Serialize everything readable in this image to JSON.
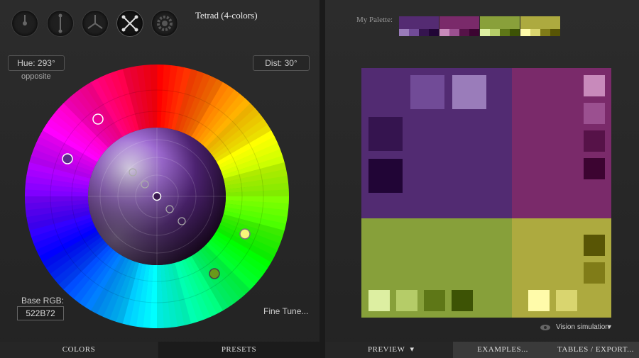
{
  "mode": {
    "title": "Tetrad (4-colors)",
    "icons": [
      "mono-icon",
      "complement-icon",
      "triad-icon",
      "tetrad-icon",
      "gear-icon"
    ],
    "active": "tetrad-icon"
  },
  "controls": {
    "hue_label": "Hue: 293°",
    "hue_sub": "opposite",
    "dist_label": "Dist: 30°",
    "base_rgb_label": "Base RGB:",
    "base_rgb_value": "522B72",
    "fine_tune": "Fine Tune..."
  },
  "left_tabs": {
    "colors": "COLORS",
    "presets": "PRESETS"
  },
  "palette": {
    "label": "My Palette:",
    "groups": [
      {
        "main": "#542B72",
        "shades": [
          "#9A7CBA",
          "#714B97",
          "#35144F",
          "#210536"
        ]
      },
      {
        "main": "#7A2A6A",
        "shades": [
          "#C88ABB",
          "#9B5090",
          "#561248",
          "#3C0431"
        ]
      },
      {
        "main": "#89A03A",
        "shades": [
          "#DDEFA2",
          "#B5CC68",
          "#5E7717",
          "#3D5305"
        ]
      },
      {
        "main": "#ADAA3F",
        "shades": [
          "#FFFBAA",
          "#D9D56F",
          "#807C18",
          "#585505"
        ]
      }
    ]
  },
  "preview": {
    "quads": {
      "primary": "#522B72",
      "secondary": "#7A2A6A",
      "tertiary": "#87A03A",
      "quaternary": "#ADAA3F"
    },
    "vision_label": "Vision simulation",
    "caret": "▾"
  },
  "right_tabs": {
    "preview": "PREVIEW",
    "examples": "EXAMPLES...",
    "tables": "TABLES / EXPORT..."
  }
}
